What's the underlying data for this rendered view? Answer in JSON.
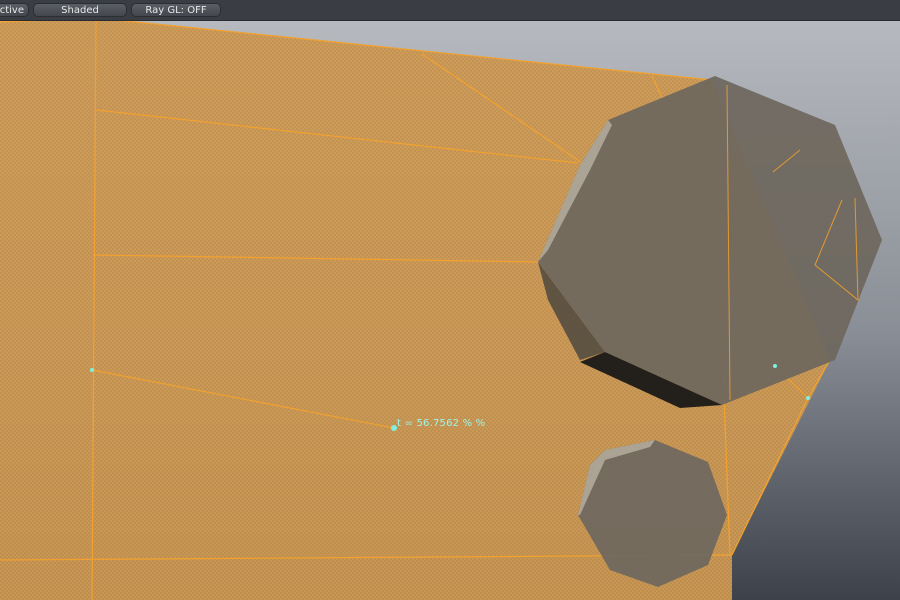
{
  "toolbar": {
    "view_mode_label": "ctive",
    "shading_label": "Shaded",
    "raygl_label": "Ray GL: OFF"
  },
  "viewport": {
    "measure_label": "t = 56.7562 % %"
  },
  "colors": {
    "background_top": "#b9bcc1",
    "background_bottom": "#3d4149",
    "mesh_fill": "#d2a05a",
    "mesh_wire": "#f2a12e",
    "stone_face": "#6e675e",
    "stone_highlight": "#aba393",
    "stone_shadow": "#28231d",
    "measure_color": "#7ff0e0"
  }
}
